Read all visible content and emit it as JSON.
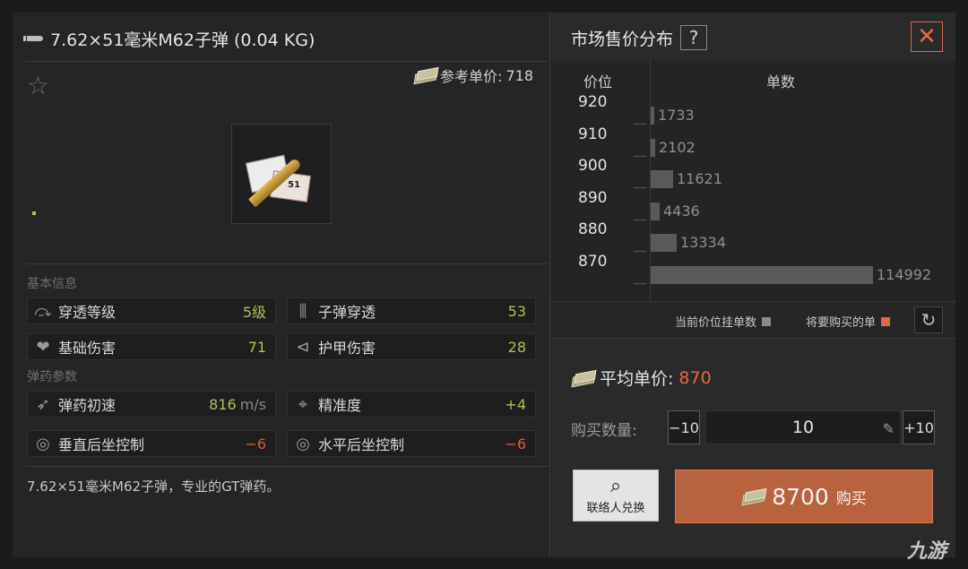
{
  "item": {
    "title": "7.62×51毫米M62子弹 (0.04 KG)",
    "ref_price_label": "参考单价:",
    "ref_price_value": "718",
    "box_label": "51",
    "description": "7.62×51毫米M62子弹，专业的GT弹药。"
  },
  "sections": {
    "basic": "基本信息",
    "ammo": "弹药参数"
  },
  "stats": [
    {
      "label": "穿透等级",
      "value": "5级",
      "icon": "penetration-icon"
    },
    {
      "label": "子弹穿透",
      "value": "53",
      "icon": "bullet-pierce-icon"
    },
    {
      "label": "基础伤害",
      "value": "71",
      "icon": "broken-heart-icon"
    },
    {
      "label": "护甲伤害",
      "value": "28",
      "icon": "armor-damage-icon"
    },
    {
      "label": "弹药初速",
      "value": "816",
      "unit": "m/s",
      "icon": "velocity-icon"
    },
    {
      "label": "精准度",
      "value": "+4",
      "icon": "crosshair-icon"
    },
    {
      "label": "垂直后坐控制",
      "value": "−6",
      "icon": "vertical-recoil-icon"
    },
    {
      "label": "水平后坐控制",
      "value": "−6",
      "icon": "horizontal-recoil-icon"
    }
  ],
  "market": {
    "title": "市场售价分布",
    "help": "?",
    "col_price": "价位",
    "col_count": "单数",
    "legend_current": "当前价位挂单数",
    "legend_buy": "将要购买的单",
    "colors": {
      "current": "#8a8a8a",
      "buy": "#e0693e",
      "bar": "#5a5a5a"
    }
  },
  "chart_data": {
    "type": "bar",
    "orientation": "horizontal",
    "categories": [
      "920",
      "910",
      "900",
      "890",
      "880",
      "870"
    ],
    "values": [
      1733,
      2102,
      11621,
      4436,
      13334,
      114992
    ],
    "xlabel": "单数",
    "ylabel": "价位"
  },
  "purchase": {
    "avg_label": "平均单价:",
    "avg_value": "870",
    "qty_label": "购买数量:",
    "minus": "−10",
    "qty": "10",
    "plus": "+10",
    "contact_label": "联络人兑换",
    "buy_amount": "8700",
    "buy_label": "购买"
  },
  "watermark": "九游"
}
